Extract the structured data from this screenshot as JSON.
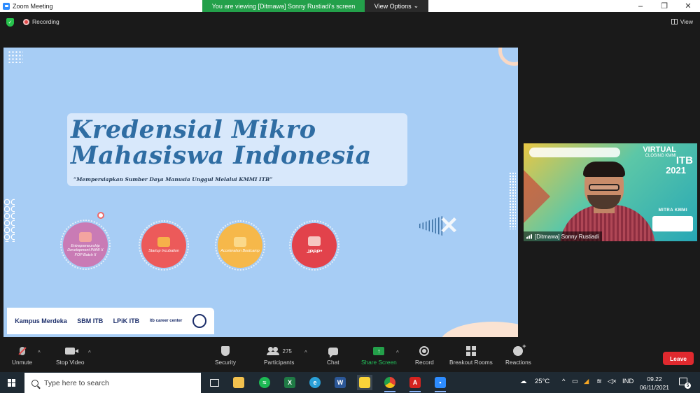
{
  "window": {
    "title": "Zoom Meeting"
  },
  "viewing_banner": {
    "text": "You are viewing [Ditmawa] Sonny Rustiadi's screen",
    "options_label": "View Options"
  },
  "topbar": {
    "recording_label": "Recording",
    "view_label": "View"
  },
  "slide": {
    "title_line1": "Kredensial Mikro",
    "title_line2": "Mahasiswa Indonesia",
    "tagline": "“Mempersiapkan Sumber Daya Manusia Unggul Melalui KMMI ITB”",
    "programs": [
      {
        "label": "Entrepreneurship Development PMW X FOP Batch II",
        "color": "#c97bb5"
      },
      {
        "label": "Startup Incubation",
        "color": "#ec5a5a"
      },
      {
        "label": "Acceleration Bootcamp",
        "color": "#f6b84a"
      },
      {
        "label": "JPPP*",
        "color": "#e2424b"
      }
    ],
    "logos": [
      "Kampus Merdeka",
      "SBM ITB",
      "LPiK ITB",
      "itb career center"
    ]
  },
  "video": {
    "participant_name": "[Ditmawa] Sonny Rustiadi",
    "bg_virtual": "VIRTUAL",
    "bg_closing": "CLOSING KMMI",
    "bg_itb": "ITB",
    "bg_year": "2021",
    "bg_mitra": "MITRA KMMI"
  },
  "toolbar": {
    "unmute": "Unmute",
    "stop_video": "Stop Video",
    "security": "Security",
    "participants": "Participants",
    "participants_count": "275",
    "chat": "Chat",
    "share_screen": "Share Screen",
    "record": "Record",
    "breakout_rooms": "Breakout Rooms",
    "reactions": "Reactions",
    "leave": "Leave"
  },
  "taskbar": {
    "search_placeholder": "Type here to search",
    "temperature": "25°C",
    "language": "IND",
    "time": "09.22",
    "date": "06/11/2021",
    "notification_count": "5"
  },
  "colors": {
    "zoom_blue": "#2d8cff",
    "green": "#23a04a",
    "leave_red": "#e0292e",
    "slide_bg": "#a7cdf5"
  }
}
